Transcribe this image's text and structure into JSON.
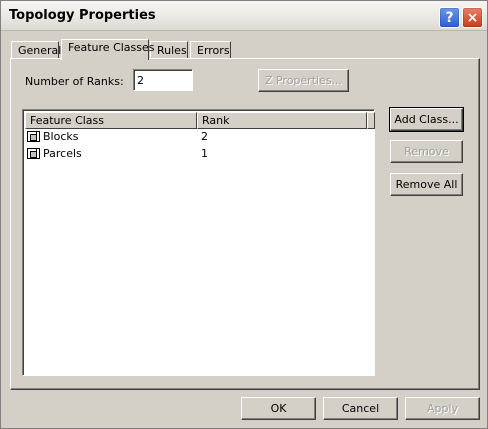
{
  "window": {
    "title": "Topology Properties"
  },
  "titlebar_buttons": {
    "help": "?",
    "close": "×"
  },
  "tabs": [
    {
      "label": "General",
      "active": false
    },
    {
      "label": "Feature Classes",
      "active": true
    },
    {
      "label": "Rules",
      "active": false
    },
    {
      "label": "Errors",
      "active": false
    }
  ],
  "ranks": {
    "label": "Number of Ranks:",
    "value": "2"
  },
  "z_properties_button": {
    "label": "Z Properties...",
    "enabled": false
  },
  "list": {
    "columns": [
      "Feature Class",
      "Rank"
    ],
    "rows": [
      {
        "name": "Blocks",
        "rank": "2",
        "icon": "feature-class-icon"
      },
      {
        "name": "Parcels",
        "rank": "1",
        "icon": "feature-class-icon"
      }
    ]
  },
  "side_buttons": {
    "add_class": "Add Class...",
    "remove": "Remove",
    "remove_all": "Remove All"
  },
  "footer": {
    "ok": "OK",
    "cancel": "Cancel",
    "apply": "Apply"
  },
  "colors": {
    "face": "#d4d0c8",
    "help": "#2c5fd3",
    "close": "#c73c1c"
  }
}
